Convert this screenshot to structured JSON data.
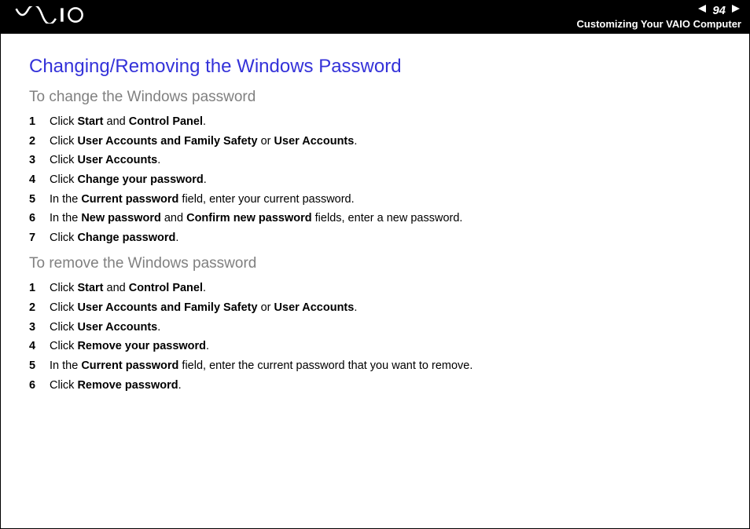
{
  "header": {
    "page_number": "94",
    "breadcrumb": "Customizing Your VAIO Computer"
  },
  "content": {
    "title": "Changing/Removing the Windows Password",
    "sections": [
      {
        "subhead": "To change the Windows password",
        "steps": [
          {
            "n": "1",
            "html": "Click <b>Start</b> and <b>Control Panel</b>."
          },
          {
            "n": "2",
            "html": "Click <b>User Accounts and Family Safety</b> or <b>User Accounts</b>."
          },
          {
            "n": "3",
            "html": "Click <b>User Accounts</b>."
          },
          {
            "n": "4",
            "html": "Click <b>Change your password</b>."
          },
          {
            "n": "5",
            "html": "In the <b>Current password</b> field, enter your current password."
          },
          {
            "n": "6",
            "html": "In the <b>New password</b> and <b>Confirm new password</b> fields, enter a new password."
          },
          {
            "n": "7",
            "html": "Click <b>Change password</b>."
          }
        ]
      },
      {
        "subhead": "To remove the Windows password",
        "steps": [
          {
            "n": "1",
            "html": "Click <b>Start</b> and <b>Control Panel</b>."
          },
          {
            "n": "2",
            "html": "Click <b>User Accounts and Family Safety</b> or <b>User Accounts</b>."
          },
          {
            "n": "3",
            "html": "Click <b>User Accounts</b>."
          },
          {
            "n": "4",
            "html": "Click <b>Remove your password</b>."
          },
          {
            "n": "5",
            "html": "In the <b>Current password</b> field, enter the current password that you want to remove."
          },
          {
            "n": "6",
            "html": "Click <b>Remove password</b>."
          }
        ]
      }
    ]
  }
}
